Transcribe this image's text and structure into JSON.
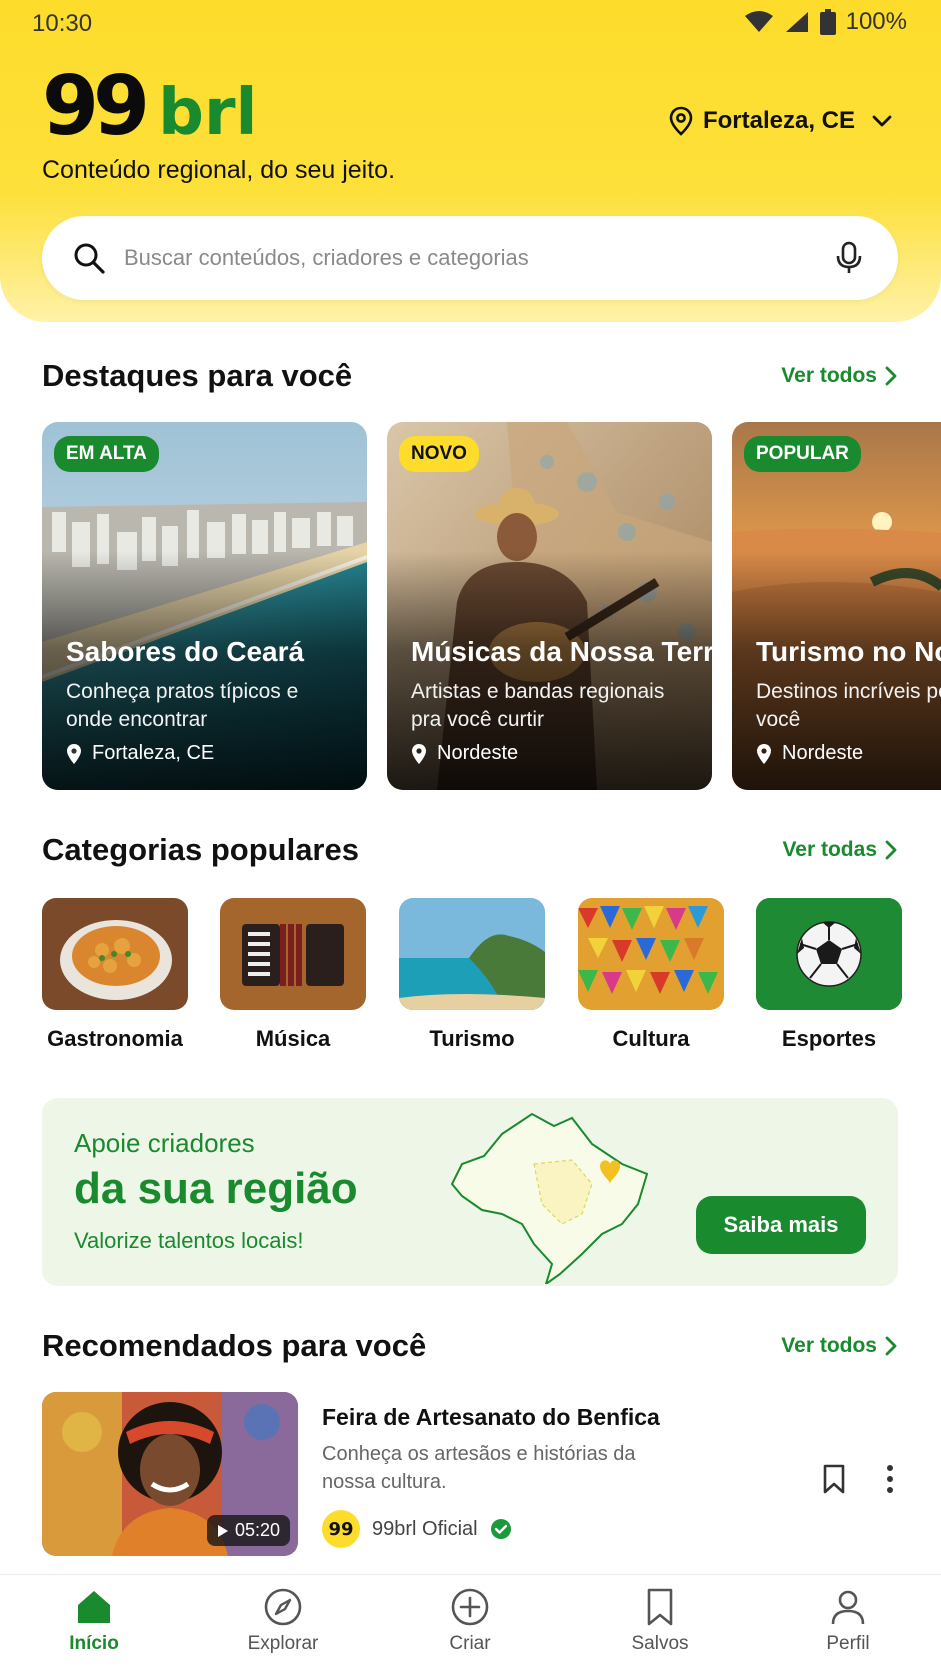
{
  "status_bar": {
    "time": "10:30",
    "battery": "100%"
  },
  "header": {
    "logo_number": "99",
    "logo_text": "brl",
    "tagline": "Conteúdo regional, do seu jeito.",
    "location": "Fortaleza, CE"
  },
  "search": {
    "placeholder": "Buscar conteúdos, criadores e categorias"
  },
  "highlights": {
    "title": "Destaques para você",
    "see_all": "Ver todos",
    "cards": [
      {
        "badge": "EM ALTA",
        "title": "Sabores do Ceará",
        "desc": "Conheça pratos típicos e onde encontrar",
        "location": "Fortaleza, CE"
      },
      {
        "badge": "NOVO",
        "title": "Músicas da Nossa Terra",
        "desc": "Artistas e bandas regionais pra você curtir",
        "location": "Nordeste"
      },
      {
        "badge": "POPULAR",
        "title": "Turismo no Nordeste",
        "desc": "Destinos incríveis perto de você",
        "location": "Nordeste"
      }
    ]
  },
  "categories": {
    "title": "Categorias populares",
    "see_all": "Ver todas",
    "items": [
      {
        "label": "Gastronomia"
      },
      {
        "label": "Música"
      },
      {
        "label": "Turismo"
      },
      {
        "label": "Cultura"
      },
      {
        "label": "Esportes"
      }
    ]
  },
  "banner": {
    "line1": "Apoie criadores",
    "line2": "da sua região",
    "line3": "Valorize talentos locais!",
    "button": "Saiba mais"
  },
  "recommended": {
    "title": "Recomendados para você",
    "see_all": "Ver todos",
    "item": {
      "title": "Feira de Artesanato do Benfica",
      "desc": "Conheça os artesãos e histórias da nossa cultura.",
      "duration": "05:20",
      "author": "99brl Oficial",
      "author_avatar": "99"
    }
  },
  "nav": [
    {
      "label": "Início",
      "icon": "home-icon",
      "active": true
    },
    {
      "label": "Explorar",
      "icon": "compass-icon"
    },
    {
      "label": "Criar",
      "icon": "plus-circle-icon"
    },
    {
      "label": "Salvos",
      "icon": "bookmark-icon"
    },
    {
      "label": "Perfil",
      "icon": "user-icon"
    }
  ],
  "colors": {
    "brand_yellow": "#FDDC2B",
    "brand_green": "#1a8a2e",
    "text": "#111111"
  }
}
